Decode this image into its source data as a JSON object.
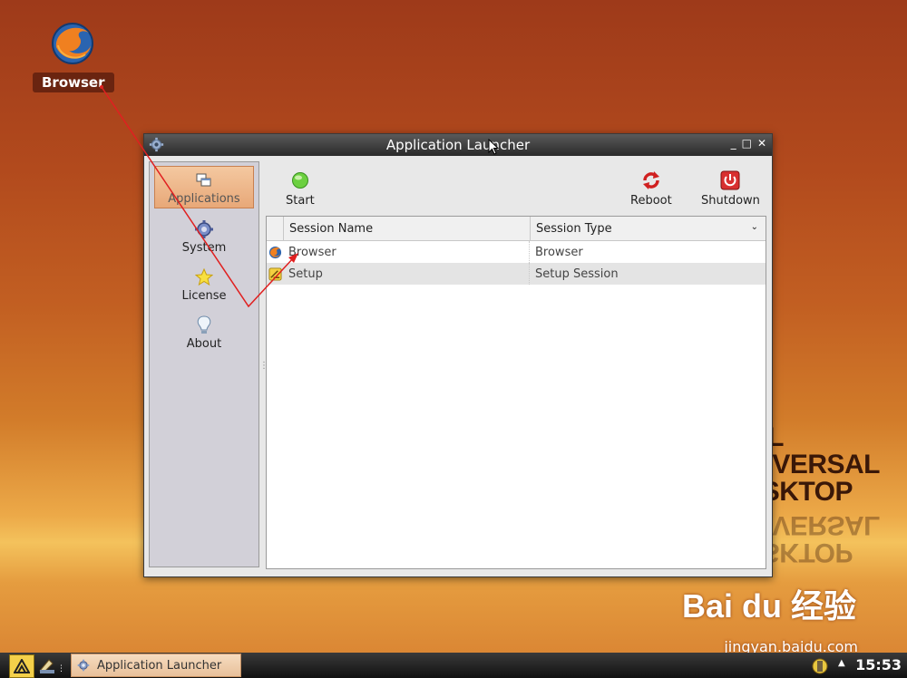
{
  "desktop": {
    "icon_label": "Browser",
    "brand_lines": [
      "L",
      "VERSAL",
      "SKTOP"
    ],
    "brand_mirror": [
      "SKTOP",
      "VERSAL"
    ],
    "watermark_logo": "Bai du 经验",
    "watermark_url": "jingyan.baidu.com"
  },
  "window": {
    "title": "Application Launcher",
    "controls": [
      "_",
      "□",
      "✕"
    ]
  },
  "sidebar": {
    "items": [
      {
        "label": "Applications",
        "icon": "applications-icon",
        "active": true
      },
      {
        "label": "System",
        "icon": "gear-icon",
        "active": false
      },
      {
        "label": "License",
        "icon": "star-icon",
        "active": false
      },
      {
        "label": "About",
        "icon": "lightbulb-icon",
        "active": false
      }
    ]
  },
  "toolbar": {
    "start_label": "Start",
    "reboot_label": "Reboot",
    "shutdown_label": "Shutdown"
  },
  "table": {
    "columns": [
      "Session Name",
      "Session Type"
    ],
    "rows": [
      {
        "name": "Browser",
        "type": "Browser",
        "icon": "firefox-icon"
      },
      {
        "name": "Setup",
        "type": "Setup Session",
        "icon": "setup-icon"
      }
    ]
  },
  "taskbar": {
    "task_label": "Application Launcher",
    "clock": "15:53"
  },
  "colors": {
    "accent": "#e8a878",
    "start_green": "#6cd040",
    "reboot_red": "#d02020",
    "annotation": "#e02020"
  }
}
